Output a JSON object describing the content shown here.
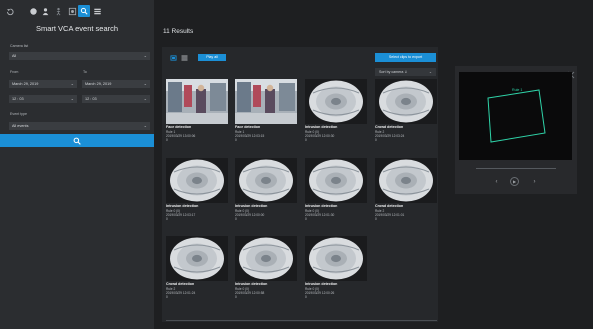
{
  "sidebar": {
    "title": "Smart VCA event search",
    "camera_label": "Camera list",
    "camera_value": "All",
    "from_label": "From",
    "to_label": "To",
    "from_date": "March 29, 2019",
    "to_date": "March 29, 2019",
    "from_time": "12 : 03",
    "to_time": "12 : 03",
    "event_type_label": "Event type",
    "event_type_value": "All events",
    "icons": [
      "back-icon",
      "camera-icon",
      "person-icon",
      "motion-icon",
      "filter-icon",
      "search-tab-icon",
      "list-icon"
    ]
  },
  "main": {
    "results_title": "11 Results",
    "play_all_label": "Play all",
    "export_label": "Select clips to export",
    "sort_label": "Sort by camera ⇓"
  },
  "results": [
    {
      "type": "Face detection",
      "rule": "Rule 1",
      "time": "2019/03/29 13:00:06",
      "id": "0",
      "thumb": "store"
    },
    {
      "type": "Face detection",
      "rule": "Rule 1",
      "time": "2019/03/29 12:03:15",
      "id": "0",
      "thumb": "store"
    },
    {
      "type": "Intrusion detection",
      "rule": "Rule 0 (0)",
      "time": "2019/03/29 12:00:30",
      "id": "0",
      "thumb": "fisheye"
    },
    {
      "type": "Crowd detection",
      "rule": "Rule 2",
      "time": "2019/03/29 12:03:24",
      "id": "0",
      "thumb": "fisheye"
    },
    {
      "type": "Intrusion detection",
      "rule": "Rule 0 (0)",
      "time": "2019/03/29 12:03:17",
      "id": "0",
      "thumb": "fisheye"
    },
    {
      "type": "Intrusion detection",
      "rule": "Rule 0 (0)",
      "time": "2019/03/29 12:00:00",
      "id": "0",
      "thumb": "fisheye"
    },
    {
      "type": "Intrusion detection",
      "rule": "Rule 0 (0)",
      "time": "2019/03/29 12:01:30",
      "id": "0",
      "thumb": "fisheye"
    },
    {
      "type": "Crowd detection",
      "rule": "Rule 2",
      "time": "2019/03/29 12:01:01",
      "id": "0",
      "thumb": "fisheye"
    },
    {
      "type": "Crowd detection",
      "rule": "Rule 2",
      "time": "2019/03/29 12:01:24",
      "id": "0",
      "thumb": "fisheye"
    },
    {
      "type": "Intrusion detection",
      "rule": "Rule 0 (0)",
      "time": "2019/03/29 12:00:58",
      "id": "0",
      "thumb": "fisheye"
    },
    {
      "type": "Intrusion detection",
      "rule": "Rule 0 (0)",
      "time": "2019/03/29 12:00:26",
      "id": "0",
      "thumb": "fisheye"
    }
  ],
  "preview": {
    "rule_label": "Rule 1",
    "controls": [
      "prev-icon",
      "play-icon",
      "next-icon"
    ]
  },
  "colors": {
    "accent": "#1b8fd6",
    "rule_region": "#2fd3a8"
  }
}
